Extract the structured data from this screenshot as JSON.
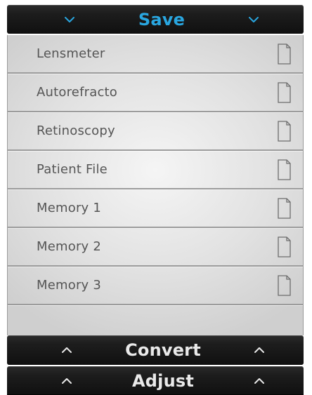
{
  "save_bar": {
    "title": "Save"
  },
  "save_items": [
    {
      "label": "Lensmeter"
    },
    {
      "label": "Autorefracto"
    },
    {
      "label": "Retinoscopy"
    },
    {
      "label": "Patient File"
    },
    {
      "label": "Memory 1"
    },
    {
      "label": "Memory 2"
    },
    {
      "label": "Memory 3"
    }
  ],
  "convert_bar": {
    "title": "Convert"
  },
  "adjust_bar": {
    "title": "Adjust"
  },
  "colors": {
    "accent": "#29a6e0",
    "bar_dark": "#141414",
    "panel_light": "#e6e6e6",
    "item_text": "#555555",
    "bar_text": "#e9e9e9"
  },
  "icons": {
    "chevron_down": "chevron-down-icon",
    "chevron_up": "chevron-up-icon",
    "document": "document-icon"
  }
}
